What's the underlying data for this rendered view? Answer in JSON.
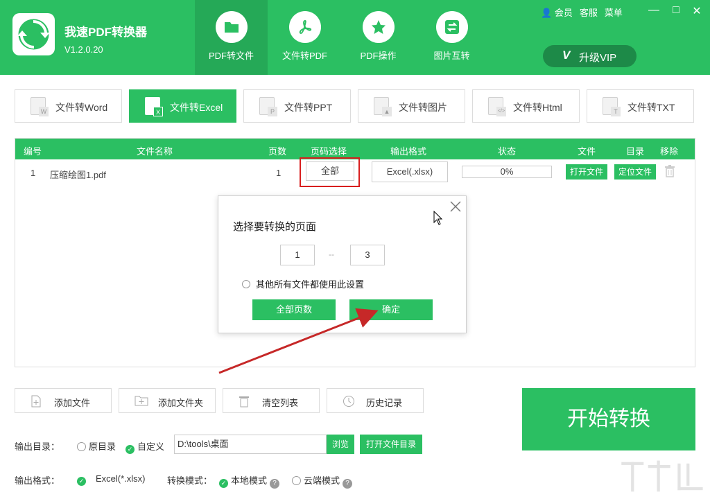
{
  "app": {
    "title": "我速PDF转换器",
    "version": "V1.2.0.20"
  },
  "main_tabs": [
    {
      "label": "PDF转文件",
      "icon": "folder-icon",
      "active": true
    },
    {
      "label": "文件转PDF",
      "icon": "pdf-icon",
      "active": false
    },
    {
      "label": "PDF操作",
      "icon": "star-icon",
      "active": false
    },
    {
      "label": "图片互转",
      "icon": "swap-icon",
      "active": false
    }
  ],
  "top_links": {
    "member": "会员",
    "service": "客服",
    "menu": "菜单"
  },
  "vip": {
    "v": "V",
    "label": "升级VIP"
  },
  "sub_tabs": [
    {
      "label": "文件转Word",
      "badge": "W",
      "active": false
    },
    {
      "label": "文件转Excel",
      "badge": "X",
      "active": true
    },
    {
      "label": "文件转PPT",
      "badge": "P",
      "active": false
    },
    {
      "label": "文件转图片",
      "badge": "▲",
      "active": false
    },
    {
      "label": "文件转Html",
      "badge": "</>",
      "active": false
    },
    {
      "label": "文件转TXT",
      "badge": "T",
      "active": false
    }
  ],
  "table": {
    "headers": {
      "no": "编号",
      "name": "文件名称",
      "pages": "页数",
      "page_select": "页码选择",
      "format": "输出格式",
      "status": "状态",
      "file": "文件",
      "dir": "目录",
      "remove": "移除"
    },
    "rows": [
      {
        "no": "1",
        "name": "压缩绘图1.pdf",
        "pages": "1",
        "page_select": "全部",
        "format": "Excel(.xlsx)",
        "progress": "0%",
        "open_file": "打开文件",
        "locate_file": "定位文件"
      }
    ]
  },
  "modal": {
    "title": "选择要转换的页面",
    "from": "1",
    "dash": "--",
    "to": "3",
    "apply_all_label": "其他所有文件都使用此设置",
    "all_pages_button": "全部页数",
    "ok_button": "确定"
  },
  "actions": {
    "add_file": "添加文件",
    "add_folder": "添加文件夹",
    "clear_list": "清空列表",
    "history": "历史记录",
    "start": "开始转换"
  },
  "output": {
    "dir_label": "输出目录：",
    "original_dir": "原目录",
    "custom": "自定义",
    "path": "D:\\tools\\桌面",
    "browse": "浏览",
    "open_dir": "打开文件目录",
    "format_label": "输出格式：",
    "format_value": "Excel(*.xlsx)",
    "mode_label": "转换模式：",
    "local_mode": "本地模式",
    "cloud_mode": "云端模式"
  },
  "colors": {
    "brand_green": "#2bbf62",
    "dark_green": "#25a957",
    "highlight_red": "#d81e1e"
  }
}
